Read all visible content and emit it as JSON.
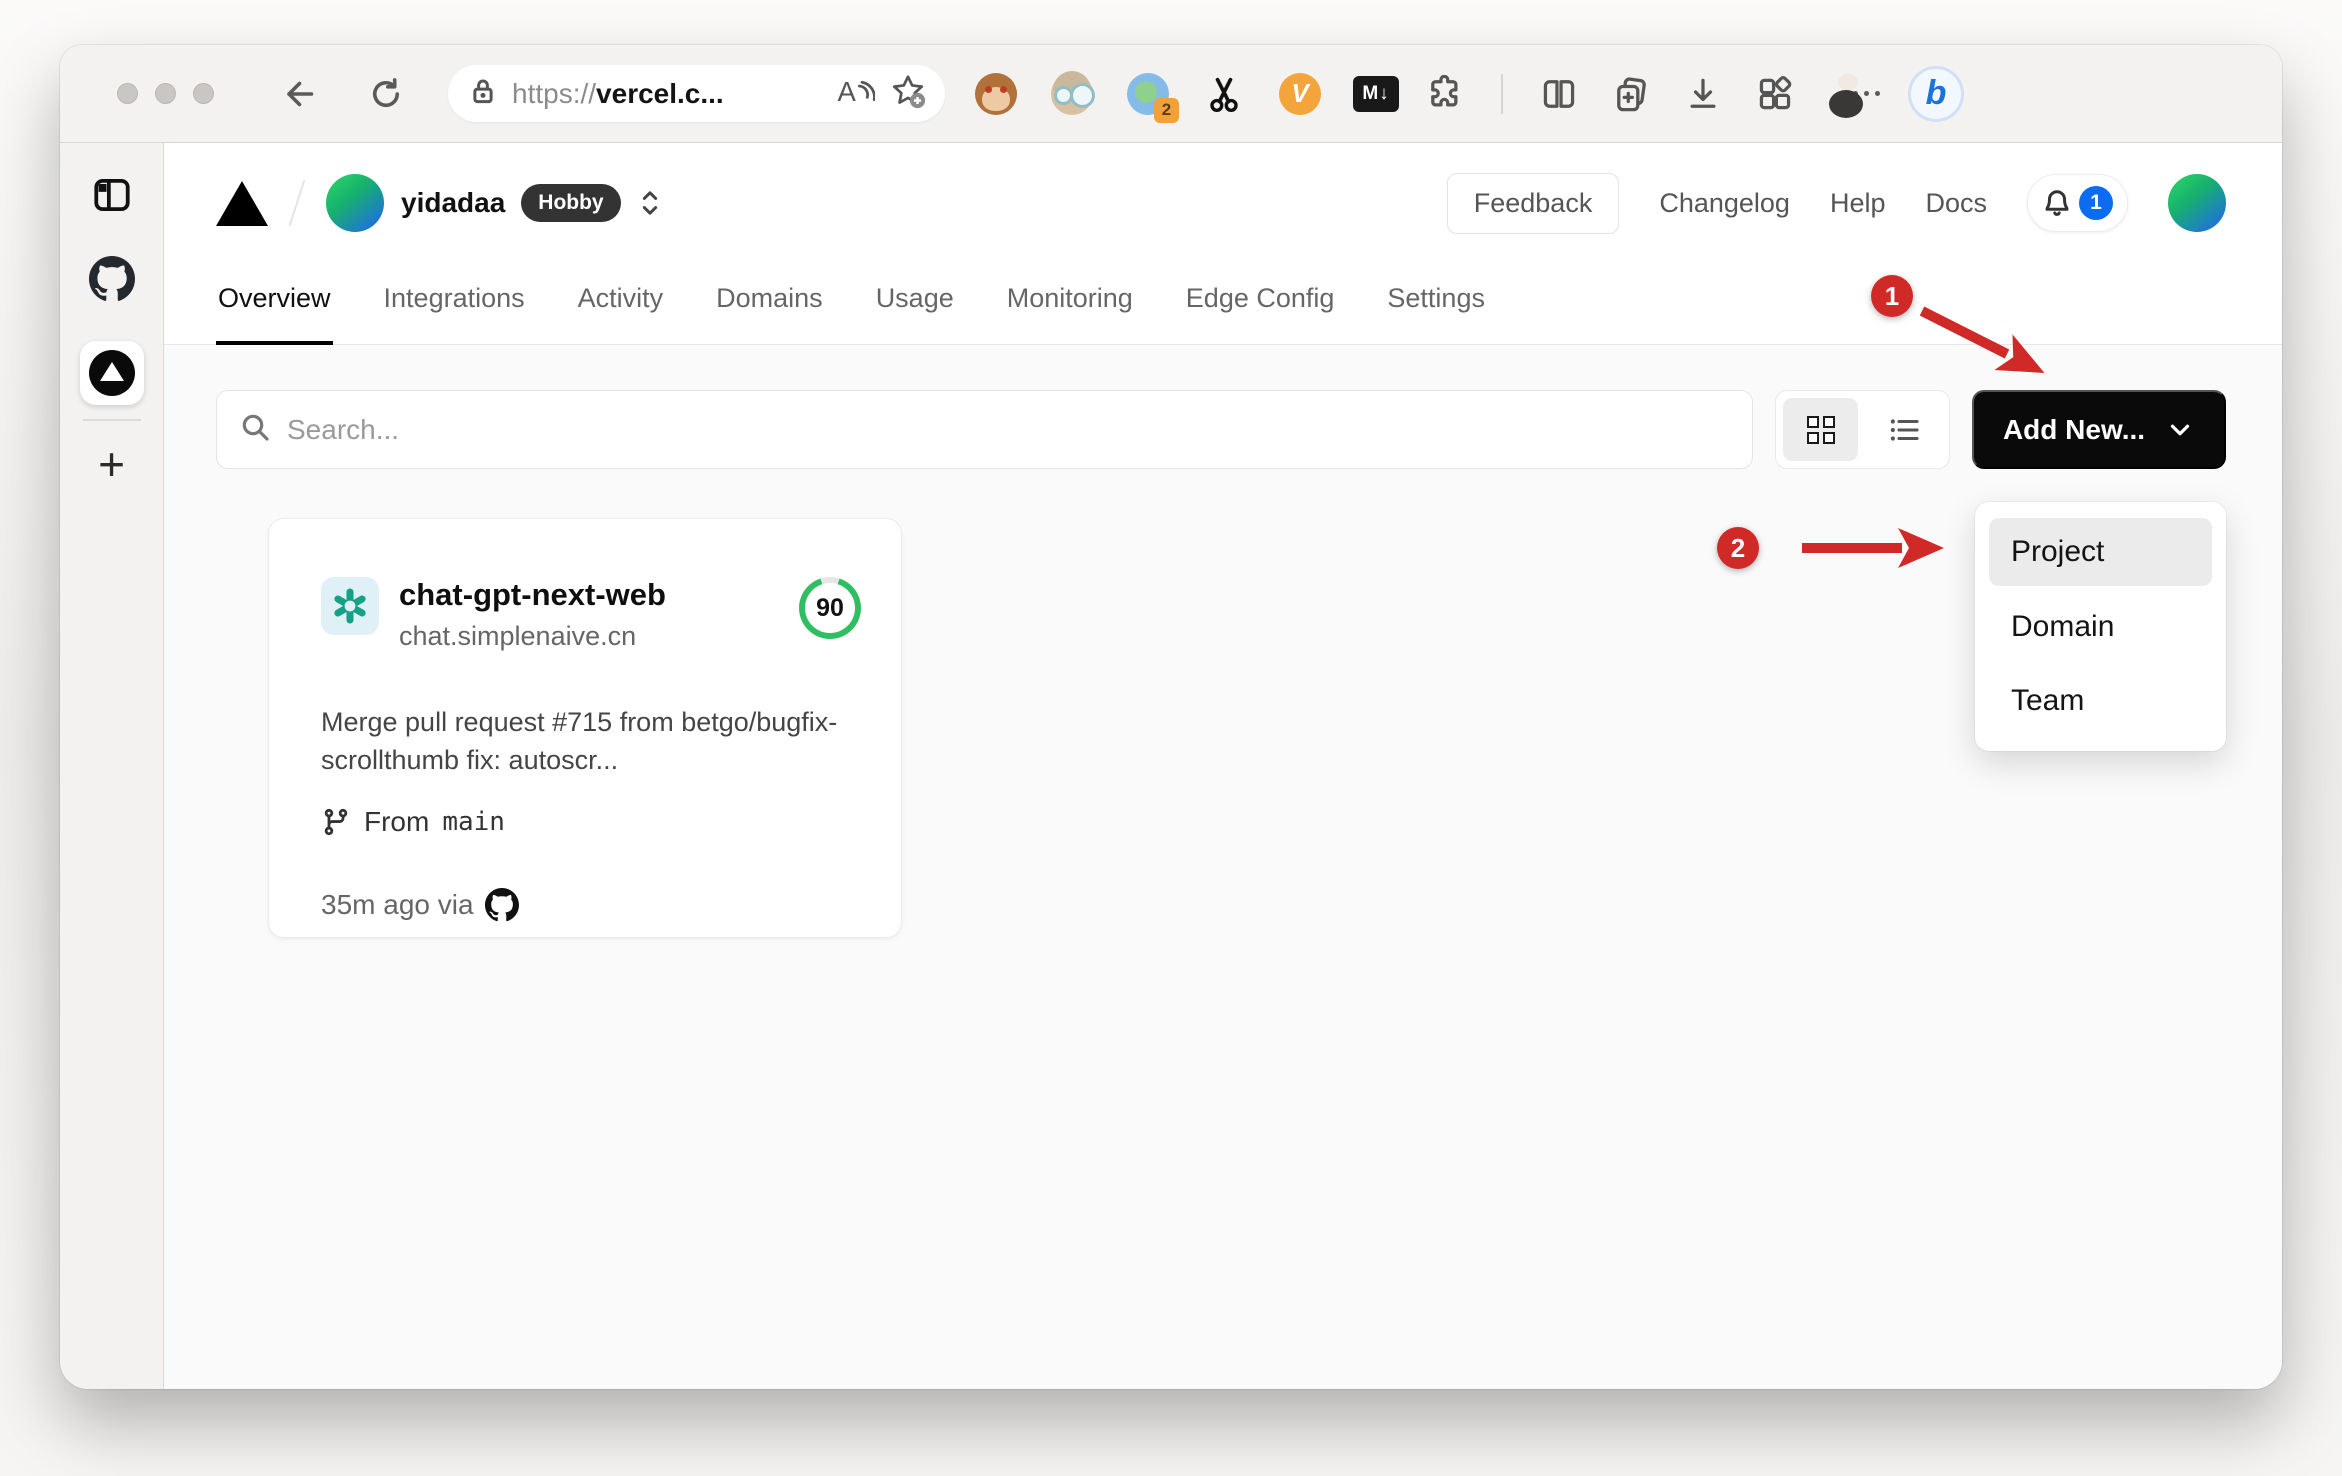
{
  "browser": {
    "url_scheme": "https://",
    "url_host": "vercel.c...",
    "translate_badge": "2",
    "v_ext_label": "V",
    "markdown_ext_label": "M↓",
    "bing_label": "b"
  },
  "sidebar": {
    "new_tab_label": "+"
  },
  "vercel": {
    "team_name": "yidadaa",
    "plan_badge": "Hobby",
    "feedback_label": "Feedback",
    "nav_changelog": "Changelog",
    "nav_help": "Help",
    "nav_docs": "Docs",
    "notification_count": "1",
    "tabs": [
      {
        "label": "Overview",
        "active": true
      },
      {
        "label": "Integrations",
        "active": false
      },
      {
        "label": "Activity",
        "active": false
      },
      {
        "label": "Domains",
        "active": false
      },
      {
        "label": "Usage",
        "active": false
      },
      {
        "label": "Monitoring",
        "active": false
      },
      {
        "label": "Edge Config",
        "active": false
      },
      {
        "label": "Settings",
        "active": false
      }
    ],
    "search_placeholder": "Search...",
    "add_new_label": "Add New...",
    "dropdown_items": [
      {
        "label": "Project",
        "highlighted": true
      },
      {
        "label": "Domain",
        "highlighted": false
      },
      {
        "label": "Team",
        "highlighted": false
      }
    ],
    "project_card": {
      "name": "chat-gpt-next-web",
      "domain": "chat.simplenaive.cn",
      "score": "90",
      "commit_message": "Merge pull request #715 from betgo/bugfix-scrollthumb fix: autoscr...",
      "branch_label": "From",
      "branch_name": "main",
      "deploy_meta": "35m ago via"
    }
  },
  "annotations": {
    "step1": "1",
    "step2": "2"
  },
  "colors": {
    "annotation_red": "#cf2a27",
    "score_green": "#2fbf62",
    "notification_blue": "#0b6cf0",
    "button_black": "#0a0a0a",
    "avatar_green": "#2bd467",
    "avatar_blue": "#1f6fe0"
  }
}
